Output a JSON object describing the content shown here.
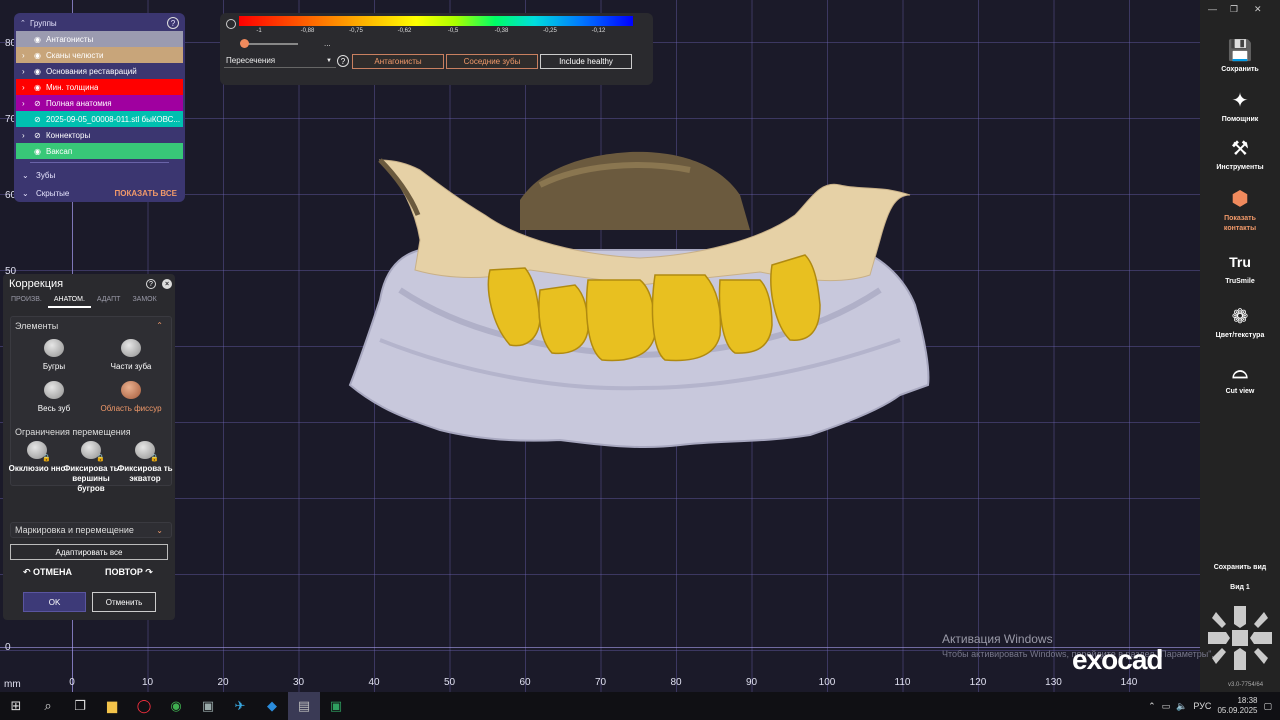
{
  "axis": {
    "unit": "mm",
    "x_ticks": [
      "0",
      "10",
      "20",
      "30",
      "40",
      "50",
      "60",
      "70",
      "80",
      "90",
      "100",
      "110",
      "120",
      "130",
      "140"
    ],
    "y_ticks": [
      "80",
      "70",
      "60",
      "50",
      "0"
    ]
  },
  "groups": {
    "header": "Группы",
    "items": [
      {
        "label": "Антагонисты",
        "color": "#9b9bb0",
        "chev": false,
        "eye": "visible"
      },
      {
        "label": "Сканы челюсти",
        "color": "#c8a57a",
        "chev": true,
        "eye": "visible"
      },
      {
        "label": "Основания реставраций",
        "color": "#3b3670",
        "chev": true,
        "eye": "visible"
      },
      {
        "label": "Мин. толщина",
        "color": "#ff0000",
        "chev": true,
        "eye": "visible"
      },
      {
        "label": "Полная анатомия",
        "color": "#a000a0",
        "chev": true,
        "eye": "hidden"
      },
      {
        "label": "2025-09-05_00008-011.stl быКОВС...",
        "color": "#00c0b0",
        "chev": false,
        "eye": "hidden"
      },
      {
        "label": "Коннекторы",
        "color": "#3b3670",
        "chev": true,
        "eye": "hidden"
      },
      {
        "label": "Ваксап",
        "color": "#38c878",
        "chev": false,
        "eye": "visible"
      }
    ],
    "teeth": "Зубы",
    "hidden": "Скрытые",
    "show_all": "ПОКАЗАТЬ ВСЕ"
  },
  "topbar": {
    "ticks": [
      "-1",
      "-0,88",
      "-0,75",
      "-0,62",
      "-0,5",
      "-0,38",
      "-0,25",
      "-0,12"
    ],
    "dots": "...",
    "select_value": "Пересечения",
    "btn_antagonists": "Антагонисты",
    "btn_adjacent": "Соседние зубы",
    "btn_healthy": "Include healthy"
  },
  "correction": {
    "title": "Коррекция",
    "tabs": [
      "ПРОИЗВ.",
      "АНАТОМ.",
      "АДАПТ",
      "ЗАМОК"
    ],
    "active_tab": "АНАТОМ.",
    "elements_title": "Элементы",
    "tools": [
      {
        "label": "Бугры"
      },
      {
        "label": "Части зуба"
      },
      {
        "label": "Весь зуб"
      },
      {
        "label": "Область фиссур"
      }
    ],
    "constraints_title": "Ограничения перемещения",
    "constraints": [
      {
        "label": "Окклюзио нно"
      },
      {
        "label": "Фиксирова ть вершины бугров"
      },
      {
        "label": "Фиксирова ть экватор"
      }
    ],
    "marking": "Маркировка и перемещение",
    "adapt_all": "Адаптировать все",
    "undo": "ОТМЕНА",
    "redo": "ПОВТОР",
    "ok": "OK",
    "cancel": "Отменить"
  },
  "rightbar": {
    "tools": [
      {
        "label": "Сохранить",
        "icon": "save-icon"
      },
      {
        "label": "Помощник",
        "icon": "wizard-icon"
      },
      {
        "label": "Инструменты",
        "icon": "tools-icon"
      },
      {
        "label": "Показать контакты",
        "icon": "contacts-icon"
      },
      {
        "label": "TruSmile",
        "icon": "trusmile-icon"
      },
      {
        "label": "Цвет/текстура",
        "icon": "palette-icon"
      },
      {
        "label": "Cut view",
        "icon": "cut-view-icon"
      }
    ],
    "save_view": "Сохранить вид",
    "view1": "Вид 1",
    "version": "v3.0-7754/64"
  },
  "watermark": {
    "line1": "Активация Windows",
    "line2": "Чтобы активировать Windows, перейдите в раздел \"Параметры\"."
  },
  "logo": "exocad",
  "taskbar": {
    "lang": "РУС",
    "time": "18:38",
    "date": "05.09.2025"
  }
}
